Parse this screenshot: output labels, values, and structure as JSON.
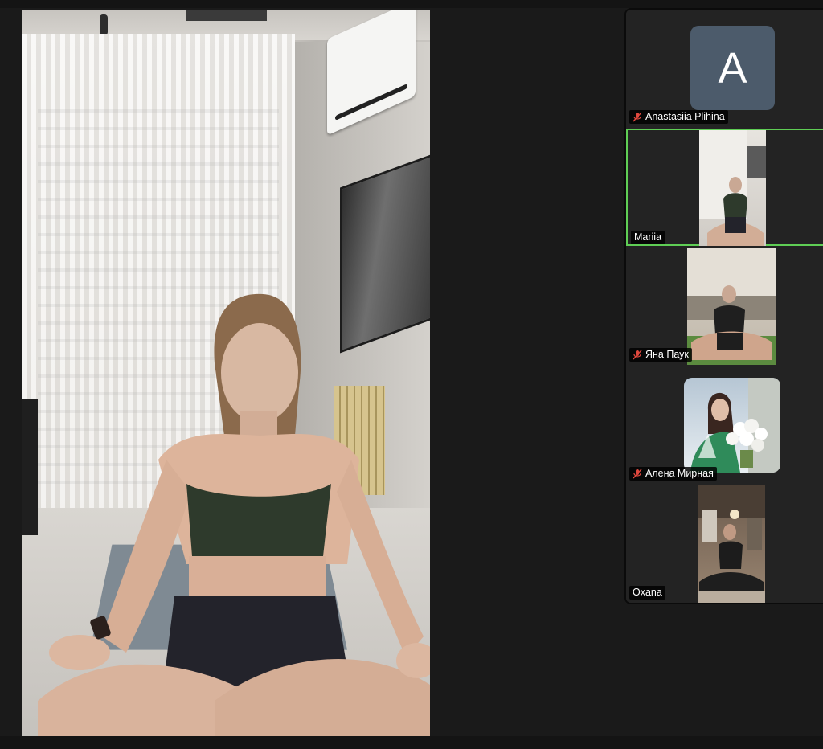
{
  "meeting": {
    "speaker": {
      "description_role": "active-speaker-video"
    },
    "participants": [
      {
        "name": "Anastasiia Plihina",
        "initial": "A",
        "muted": true,
        "video": false,
        "avatar_color": "#4c5b6b"
      },
      {
        "name": "Mariia",
        "muted": false,
        "video": true,
        "active_speaker": true,
        "highlight_color": "#5fce55"
      },
      {
        "name": "Яна Паук",
        "muted": true,
        "video": true
      },
      {
        "name": "Алена Мирная",
        "muted": true,
        "video": true
      },
      {
        "name": "Oxana",
        "muted": false,
        "video": true
      }
    ]
  },
  "colors": {
    "mute_icon": "#e0483e",
    "panel_bg": "#232323",
    "active_border": "#5fce55"
  },
  "icons": {
    "mute": "microphone-muted-icon"
  }
}
